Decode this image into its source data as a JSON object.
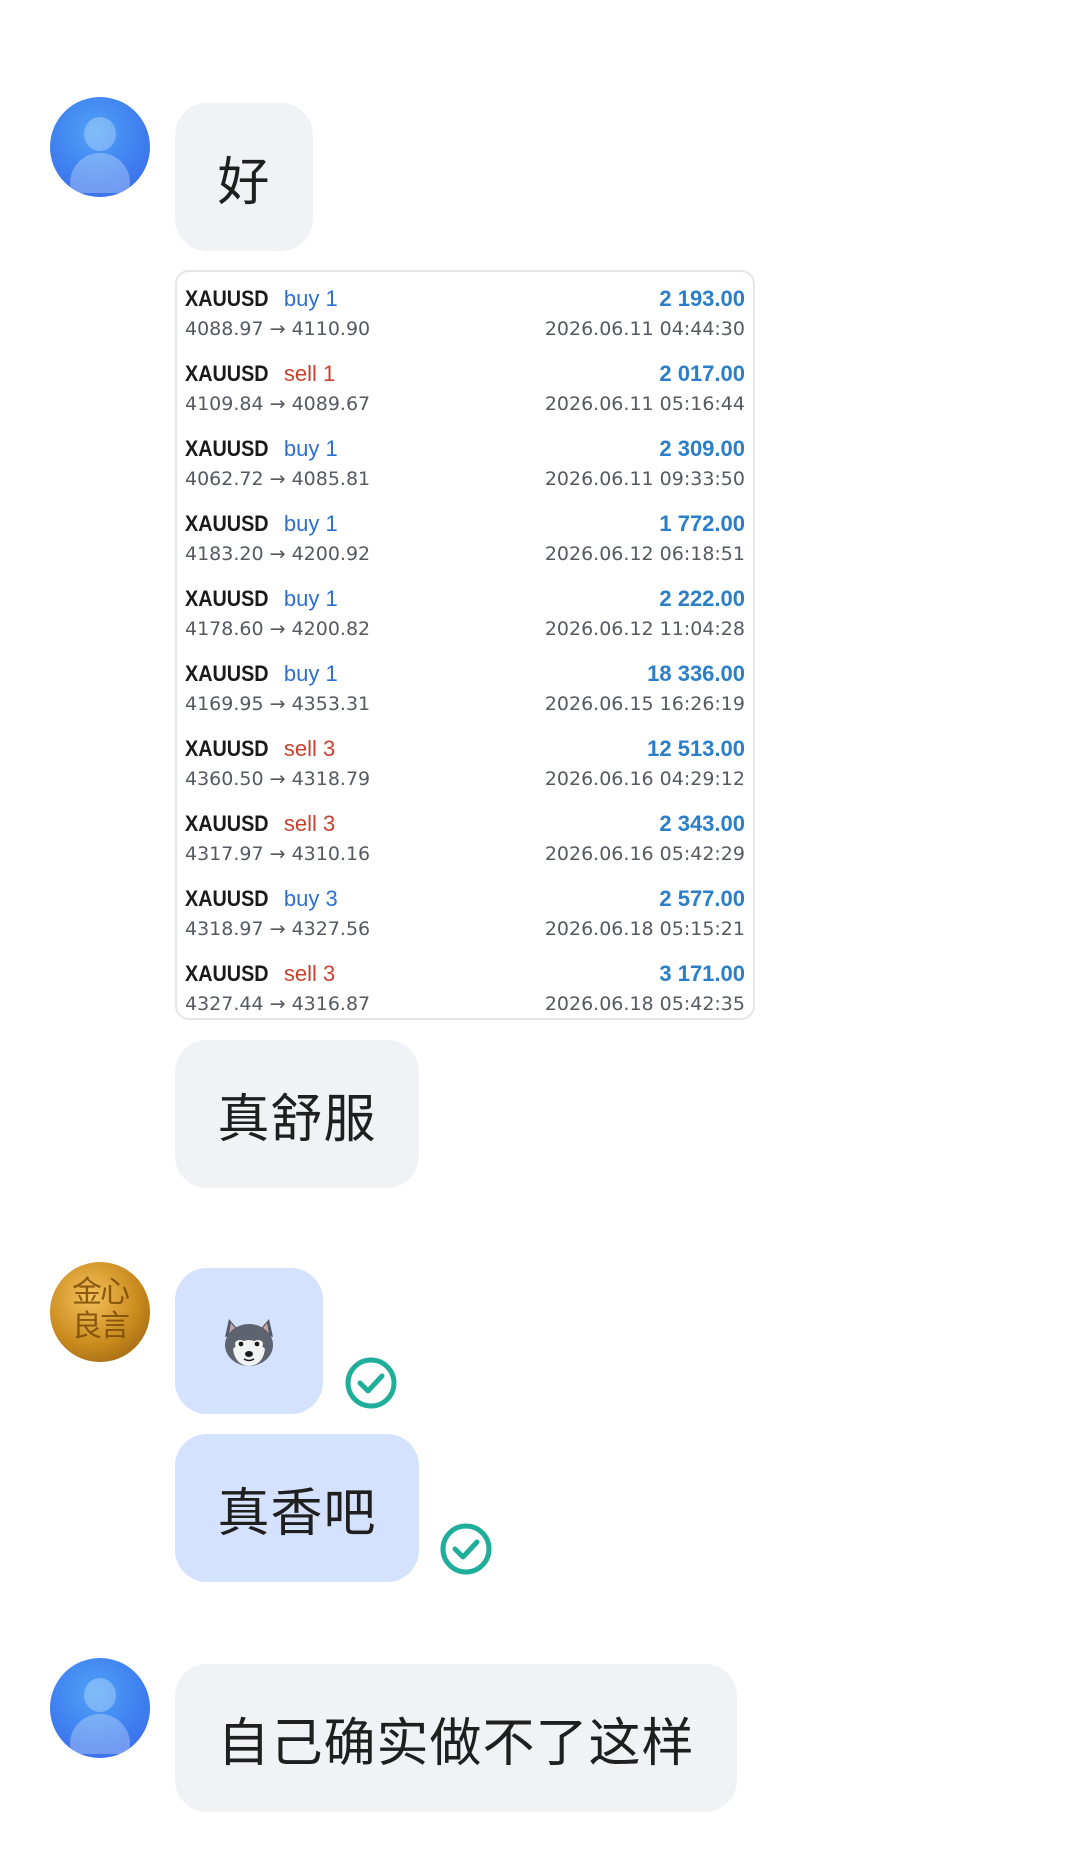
{
  "messages": {
    "reply_ok": "好",
    "comfortable": "真舒服",
    "smells_good": "真香吧",
    "cant_do": "自己确实做不了这样"
  },
  "avatar_gold_text": "金心良言",
  "emoji": "husky-dog-face",
  "trades": [
    {
      "symbol": "XAUUSD",
      "dir": "buy",
      "lots": "1",
      "prices": "4088.97 → 4110.90",
      "profit": "2 193.00",
      "time": "2026.06.11 04:44:30"
    },
    {
      "symbol": "XAUUSD",
      "dir": "sell",
      "lots": "1",
      "prices": "4109.84 → 4089.67",
      "profit": "2 017.00",
      "time": "2026.06.11 05:16:44"
    },
    {
      "symbol": "XAUUSD",
      "dir": "buy",
      "lots": "1",
      "prices": "4062.72 → 4085.81",
      "profit": "2 309.00",
      "time": "2026.06.11 09:33:50"
    },
    {
      "symbol": "XAUUSD",
      "dir": "buy",
      "lots": "1",
      "prices": "4183.20 → 4200.92",
      "profit": "1 772.00",
      "time": "2026.06.12 06:18:51"
    },
    {
      "symbol": "XAUUSD",
      "dir": "buy",
      "lots": "1",
      "prices": "4178.60 → 4200.82",
      "profit": "2 222.00",
      "time": "2026.06.12 11:04:28"
    },
    {
      "symbol": "XAUUSD",
      "dir": "buy",
      "lots": "1",
      "prices": "4169.95 → 4353.31",
      "profit": "18 336.00",
      "time": "2026.06.15 16:26:19"
    },
    {
      "symbol": "XAUUSD",
      "dir": "sell",
      "lots": "3",
      "prices": "4360.50 → 4318.79",
      "profit": "12 513.00",
      "time": "2026.06.16 04:29:12"
    },
    {
      "symbol": "XAUUSD",
      "dir": "sell",
      "lots": "3",
      "prices": "4317.97 → 4310.16",
      "profit": "2 343.00",
      "time": "2026.06.16 05:42:29"
    },
    {
      "symbol": "XAUUSD",
      "dir": "buy",
      "lots": "3",
      "prices": "4318.97 → 4327.56",
      "profit": "2 577.00",
      "time": "2026.06.18 05:15:21"
    },
    {
      "symbol": "XAUUSD",
      "dir": "sell",
      "lots": "3",
      "prices": "4327.44 → 4316.87",
      "profit": "3 171.00",
      "time": "2026.06.18 05:42:35"
    }
  ],
  "colors": {
    "buy": "#2b6fd1",
    "sell": "#c7412f",
    "profit": "#2b7ec8",
    "bubble_incoming": "#f1f2f5",
    "bubble_outgoing": "#d4e2ff",
    "read_check": "#1fae9a"
  }
}
